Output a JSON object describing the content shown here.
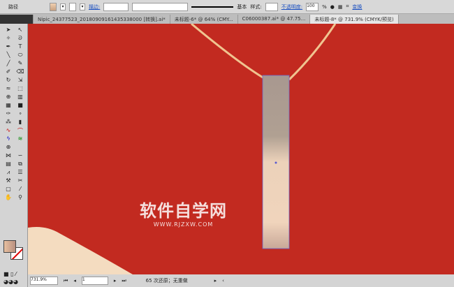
{
  "control_bar": {
    "object_label": "路径",
    "stroke_label": "描边:",
    "stroke_profile": "基本",
    "style_label": "样式:",
    "opacity_label": "不透明度:",
    "opacity_value": "100",
    "opacity_unit": "%",
    "transform_link": "变换"
  },
  "tabs": [
    {
      "label": "Nipic_24377523_20180909161435338000 [转换].ai*"
    },
    {
      "label": "未标题-6* @ 64% (CMY..."
    },
    {
      "label": "C06000387.ai* @ 47.75..."
    },
    {
      "label": "未标题-8* @ 731.9% (CMYK/预览)",
      "active": true
    }
  ],
  "status_bar": {
    "zoom": "731.9%",
    "page": "1",
    "message": "65 次还原；无重做"
  },
  "watermark": {
    "title": "软件自学网",
    "url": "WWW.RJZXW.COM"
  },
  "colors": {
    "canvas": "#c22a20",
    "rope": "#f0c490",
    "pendant_top": "#a89890",
    "pendant_bottom": "#f0d4bc"
  }
}
